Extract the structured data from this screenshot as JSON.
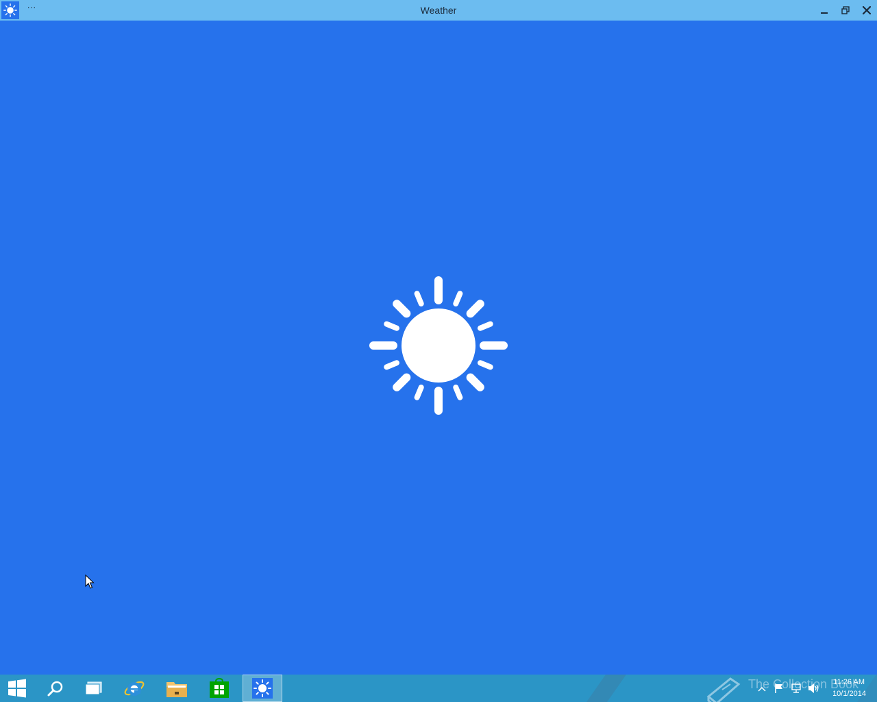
{
  "window": {
    "title": "Weather",
    "menu_label": "···",
    "icon": "sun-icon"
  },
  "window_controls": {
    "minimize_icon": "minimize-icon",
    "maximize_icon": "restore-icon",
    "close_icon": "close-icon"
  },
  "content": {
    "splash_icon": "sun-icon",
    "background_color": "#2672ec",
    "foreground_color": "#ffffff"
  },
  "titlebar_color": "#6cbcf0",
  "taskbar": {
    "color": "#2b95c6",
    "items": [
      {
        "name": "start",
        "icon": "windows-logo-icon"
      },
      {
        "name": "search",
        "icon": "search-icon"
      },
      {
        "name": "task-view",
        "icon": "task-view-icon"
      },
      {
        "name": "internet-explorer",
        "icon": "internet-explorer-icon"
      },
      {
        "name": "file-explorer",
        "icon": "folder-icon"
      },
      {
        "name": "store",
        "icon": "store-icon"
      },
      {
        "name": "weather",
        "icon": "sun-icon",
        "active": true
      }
    ],
    "watermark": "The Collection Book",
    "tray_icons": [
      "chevron-up-icon",
      "flag-icon",
      "network-icon",
      "volume-icon"
    ],
    "clock": {
      "time": "11:26 AM",
      "date": "10/1/2014"
    }
  }
}
